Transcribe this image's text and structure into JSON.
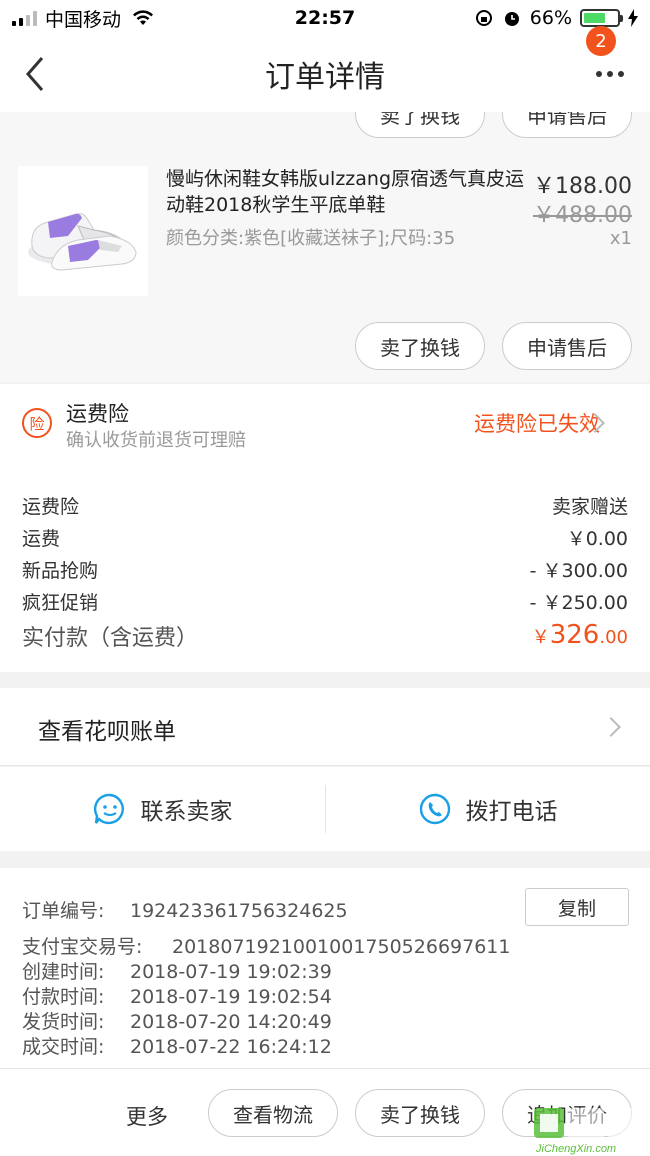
{
  "status_bar": {
    "carrier": "中国移动",
    "time": "22:57",
    "battery": "66%",
    "battery_level": 0.66
  },
  "nav": {
    "title": "订单详情",
    "badge_count": "2"
  },
  "peek_buttons": {
    "sell": "卖了换钱",
    "after_sale": "申请售后"
  },
  "product": {
    "title": "慢屿休闲鞋女韩版ulzzang原宿透气真皮运动鞋2018秋学生平底单鞋",
    "spec": "颜色分类:紫色[收藏送袜子];尺码:35",
    "price": "￥188.00",
    "original_price": "￥488.00",
    "quantity": "x1",
    "actions": {
      "sell": "卖了换钱",
      "after_sale": "申请售后"
    }
  },
  "insurance": {
    "icon_text": "险",
    "title": "运费险",
    "subtitle": "确认收货前退货可理赔",
    "status": "运费险已失效"
  },
  "fees": {
    "rows": [
      {
        "label": "运费险",
        "value": "卖家赠送"
      },
      {
        "label": "运费",
        "value": "￥0.00"
      },
      {
        "label": "新品抢购",
        "value": "- ￥300.00"
      },
      {
        "label": "疯狂促销",
        "value": "- ￥250.00"
      }
    ],
    "total_label": "实付款（含运费）",
    "total_currency": "￥",
    "total_integer": "326",
    "total_decimal": ".00"
  },
  "huabei": {
    "label": "查看花呗账单"
  },
  "contact": {
    "seller": "联系卖家",
    "call": "拨打电话"
  },
  "order_info": {
    "order_no_label": "订单编号:",
    "order_no": "192423361756324625",
    "copy": "复制",
    "alipay_label": "支付宝交易号:",
    "alipay_no": "2018071921001001750526697611",
    "created_label": "创建时间:",
    "created": "2018-07-19 19:02:39",
    "paid_label": "付款时间:",
    "paid": "2018-07-19 19:02:54",
    "shipped_label": "发货时间:",
    "shipped": "2018-07-20 14:20:49",
    "done_label": "成交时间:",
    "done": "2018-07-22 16:24:12"
  },
  "bottom_bar": {
    "more": "更多",
    "logistics": "查看物流",
    "sell": "卖了换钱",
    "review": "追加评价"
  },
  "watermark": {
    "text": "JiChengXin.com"
  },
  "colors": {
    "accent": "#f2531d",
    "contact_blue": "#1aa0e6",
    "battery_green": "#4cd964"
  }
}
